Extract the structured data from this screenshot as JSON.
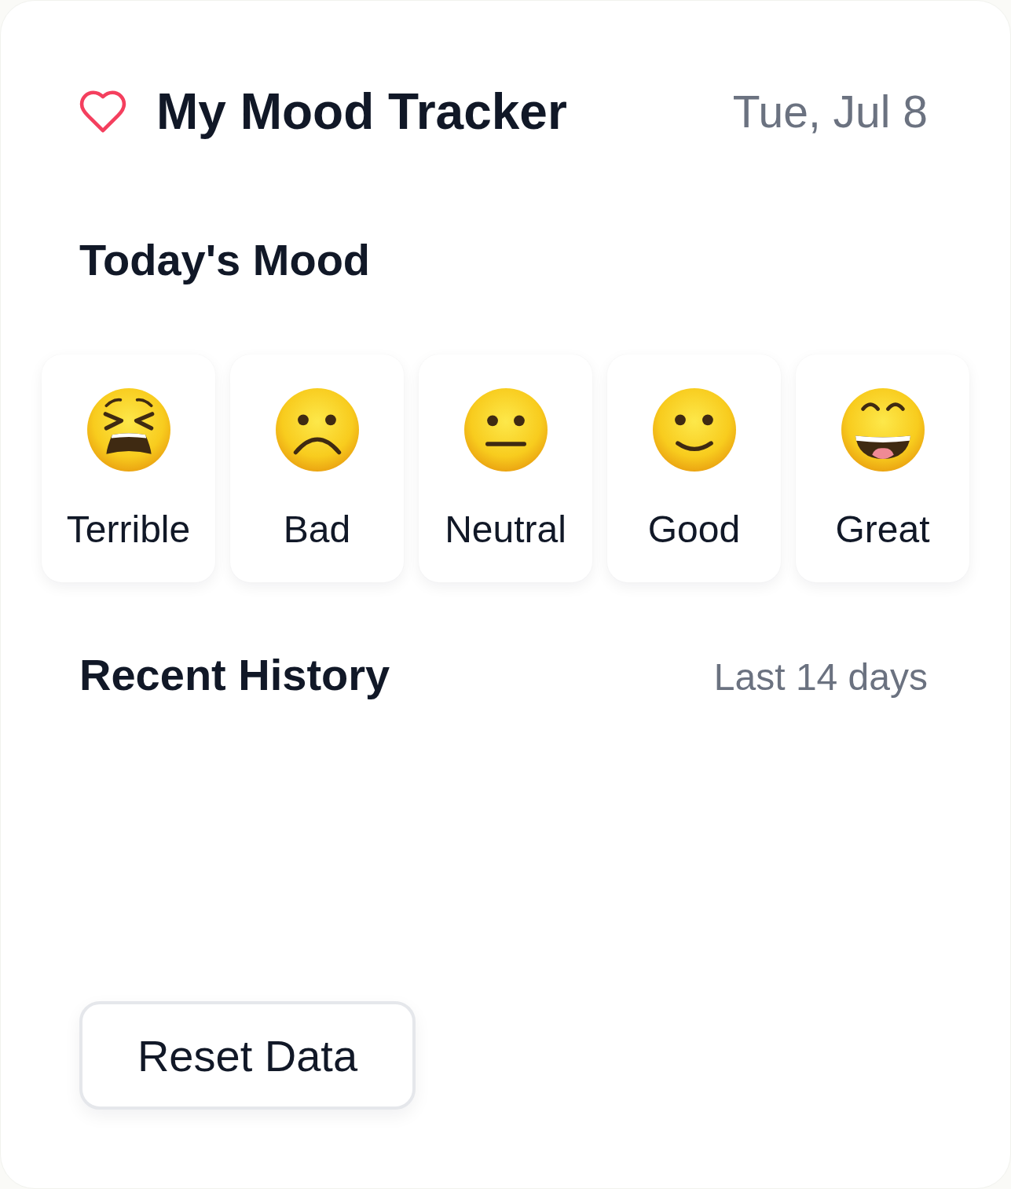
{
  "header": {
    "title": "My Mood Tracker",
    "date": "Tue, Jul 8"
  },
  "todays_mood": {
    "heading": "Today's Mood",
    "moods": [
      {
        "kind": "tired",
        "label": "Terrible",
        "selected": false
      },
      {
        "kind": "frown",
        "label": "Bad",
        "selected": false
      },
      {
        "kind": "neutral",
        "label": "Neutral",
        "selected": false
      },
      {
        "kind": "smile",
        "label": "Good",
        "selected": false
      },
      {
        "kind": "grin",
        "label": "Great",
        "selected": false
      }
    ]
  },
  "history": {
    "heading": "Recent History",
    "range": "Last 14 days"
  },
  "reset_button": {
    "label": "Reset Data"
  }
}
